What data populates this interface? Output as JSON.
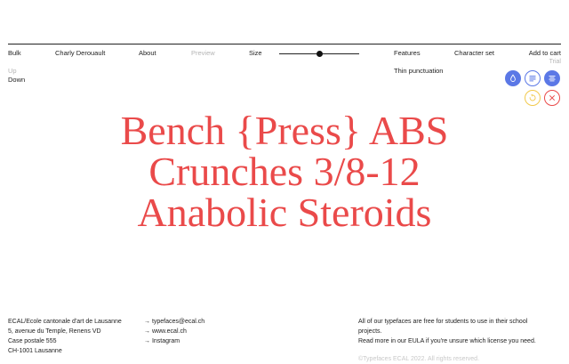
{
  "nav": {
    "bulk": "Bulk",
    "designer": "Charly Derouault",
    "about": "About",
    "preview": "Preview",
    "size": "Size",
    "size_value": 0.5,
    "features": "Features",
    "character_set": "Character set",
    "add_to_cart": "Add to cart",
    "trial": "Trial"
  },
  "direction": {
    "up": "Up",
    "down": "Down"
  },
  "features": {
    "active": "Thin punctuation"
  },
  "icons": [
    {
      "name": "ink-drop-icon",
      "color": "#5b78e6",
      "filled": true
    },
    {
      "name": "align-left-icon",
      "color": "#5b78e6",
      "filled": false
    },
    {
      "name": "align-center-icon",
      "color": "#5b78e6",
      "filled": true
    },
    {
      "name": "shuffle-icon",
      "color": "#f2c94c",
      "filled": false
    },
    {
      "name": "close-icon",
      "color": "#ea4a4a",
      "filled": false
    }
  ],
  "specimen": {
    "lines": [
      "Bench {Press} ABS",
      "Crunches 3/8-12",
      "Anabolic Steroids"
    ],
    "color": "#ea4a4a"
  },
  "footer": {
    "address": [
      "ECAL/Ecole cantonale d'art de Lausanne",
      "5, avenue du Temple, Renens VD",
      "Case postale 555",
      "CH-1001 Lausanne"
    ],
    "links": [
      "→ typefaces@ecal.ch",
      "→ www.ecal.ch",
      "→ Instagram"
    ],
    "license": [
      "All of our typefaces are free for students to use in their school",
      "projects.",
      "Read more in our EULA if you're unsure which license you need."
    ],
    "copyright": "©Typefaces ECAL 2022. All rights reserved."
  }
}
